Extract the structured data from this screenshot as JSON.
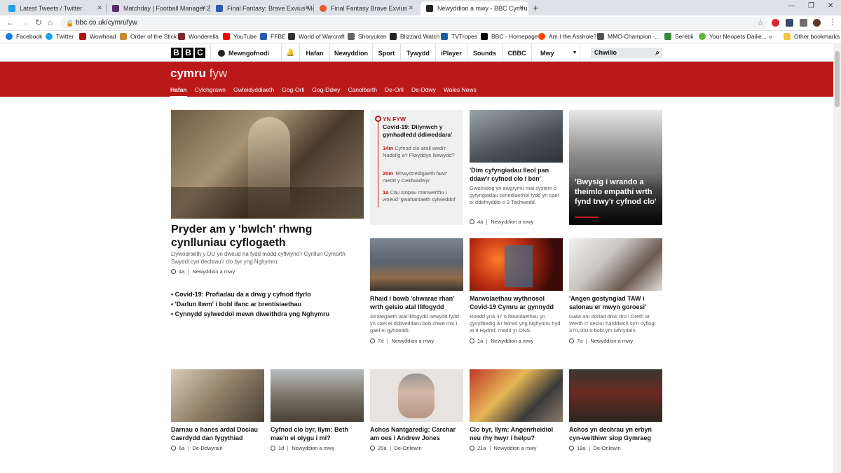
{
  "tabs": [
    {
      "title": "Latest Tweets / Twitter",
      "color": "#1da1f2"
    },
    {
      "title": "Matchday | Football Manager 20...",
      "color": "#5b2c6f"
    },
    {
      "title": "Final Fantasy: Brave Exvius Mess...",
      "color": "#2a5daa"
    },
    {
      "title": "Final Fantasy Brave Exvius",
      "color": "#e8562a"
    },
    {
      "title": "Newyddion a mwy - BBC Cymru ...",
      "color": "#222222"
    }
  ],
  "url": "bbc.co.uk/cymrufyw",
  "bookmarks": [
    {
      "label": "Facebook",
      "color": "#1877f2"
    },
    {
      "label": "Twitter",
      "color": "#1da1f2"
    },
    {
      "label": "Wowhead",
      "color": "#b1130f"
    },
    {
      "label": "Order of the Stick",
      "color": "#c98a33"
    },
    {
      "label": "Wonderella",
      "color": "#7a2a2a"
    },
    {
      "label": "YouTube",
      "color": "#ff0000"
    },
    {
      "label": "FFBE",
      "color": "#2a5daa"
    },
    {
      "label": "World of Warcraft",
      "color": "#333333"
    },
    {
      "label": "Shoryuken",
      "color": "#666666"
    },
    {
      "label": "Blizzard Watch",
      "color": "#222222"
    },
    {
      "label": "TVTropes",
      "color": "#1a5d9e"
    },
    {
      "label": "BBC - Homepage",
      "color": "#000000"
    },
    {
      "label": "Am I the Asshole?",
      "color": "#ff4500"
    },
    {
      "label": "MMO-Champion -...",
      "color": "#555555"
    },
    {
      "label": "Serebii",
      "color": "#3a8a3a"
    },
    {
      "label": "Your Neopets Dailie...",
      "color": "#62b33a"
    },
    {
      "label": "Other bookmarks",
      "color": "#f4c542"
    }
  ],
  "bbc": {
    "logo": [
      "B",
      "B",
      "C"
    ],
    "signin": "Mewngofnodi",
    "nav": [
      "Hafan",
      "Newyddion",
      "Sport",
      "Tywydd",
      "iPlayer",
      "Sounds",
      "CBBC",
      "Mwy"
    ],
    "search": "Chwilio"
  },
  "banner": {
    "brand_bold": "cymru",
    "brand_light": "fyw",
    "subnav": [
      "Hafan",
      "Cylchgrawn",
      "Gwleidyddiaeth",
      "Gog-Orll",
      "Gog-Ddwy",
      "Canolbarth",
      "De-Orll",
      "De-Ddwy",
      "Wales News"
    ]
  },
  "lead": {
    "headline": "Pryder am y 'bwlch' rhwng cynlluniau cyflogaeth",
    "summary": "Llywodraeth y DU yn dweud na fydd modd cyflwyno'r Cynllun Cymorth Swyddi cyn dechrau'r clo byr yng Nghymru.",
    "time": "4a",
    "section": "Newyddion a mwy",
    "related": [
      "Covid-19: Profiadau da a drwg y cyfnod ffyrlo",
      "'Darlun llwm' i bobl ifanc ar brentisiaethau",
      "Cynnydd sylweddol mewn diweithdra yng Nghymru"
    ]
  },
  "live": {
    "label": "YN FYW",
    "headline": "Covid-19: Dilynwch y gynhadledd ddiweddara'",
    "items": [
      {
        "time": "14m",
        "text": "Cyfnod clo arall wedi'r Nadolig a'r Flwyddyn Newydd?"
      },
      {
        "time": "20m",
        "text": "'Rhwystredigaeth fawr' medd y Ceidwadwyr"
      },
      {
        "time": "1a",
        "text": "Cau siopau manwerthu i wneud 'gwahaniaeth sylweddol'"
      }
    ]
  },
  "stories": [
    {
      "headline": "'Dim cyfyngiadau lleol pan ddaw'r cyfnod clo i ben'",
      "summary": "Gweinidog yn awgrymu mai system o gyfyngiadau cenedlaethol fydd yn cael ei ddefnyddio o 9 Tachwedd.",
      "time": "4a",
      "section": "Newyddion a mwy"
    },
    {
      "headline": "'Bwysig i wrando a theimlo empathi wrth fynd trwy'r cyfnod clo'"
    },
    {
      "headline": "Rhaid i bawb 'chwarae rhan' wrth geisio atal llifogydd",
      "summary": "Strategaeth atal llifogydd newydd fydd yn cael ei ddiweddaru bob chwe mis i gael ei gyhoeddi.",
      "time": "7a",
      "section": "Newyddion a mwy"
    },
    {
      "headline": "Marwolaethau wythnosol Covid-19 Cymru ar gynnydd",
      "summary": "Roedd yna 37 o farwolaethau yn gysylltiedig â'r feirws yng Nghymru hyd at 9 Hydref, medd yr ONS.",
      "time": "1a",
      "section": "Newyddion a mwy"
    },
    {
      "headline": "'Angen gostyngiad TAW i salonau er mwyn goroesi'",
      "summary": "Galw am doriad dros dro i Dreth ar Werth i'r sector harddwch sy'n cyflogi 370,000 o bobl ym Mhrydain.",
      "time": "7a",
      "section": "Newyddion a mwy"
    }
  ],
  "bottom": [
    {
      "headline": "Darnau o hanes ardal Dociau Caerdydd dan fygythiad",
      "time": "6a",
      "section": "De-Ddwyrain"
    },
    {
      "headline": "Cyfnod clo byr, llym: Beth mae'n ei olygu i mi?",
      "time": "1d",
      "section": "Newyddion a mwy"
    },
    {
      "headline": "Achos Nantgaredig: Carchar am oes i Andrew Jones",
      "time": "20a",
      "section": "De-Orllewin"
    },
    {
      "headline": "Clo byr, llym: Angenrheidiol neu rhy hwyr i helpu?",
      "time": "21a",
      "section": "Newyddion a mwy"
    },
    {
      "headline": "Achos yn dechrau yn erbyn cyn-weithiwr siop Gymraeg",
      "time": "19a",
      "section": "De-Orllewin"
    }
  ]
}
